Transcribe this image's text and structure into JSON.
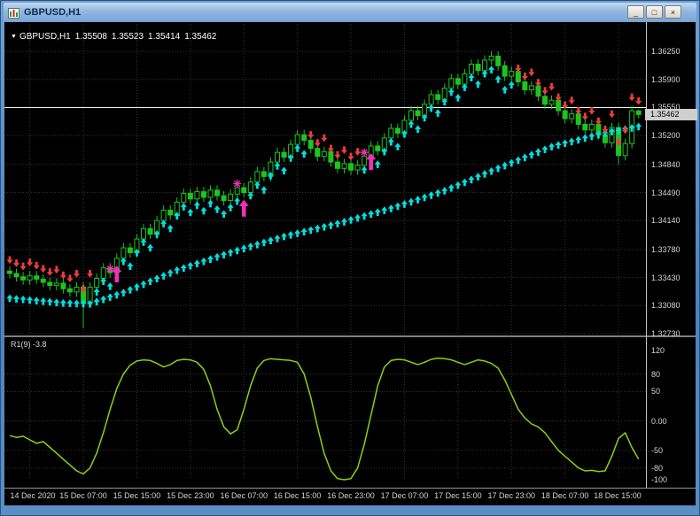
{
  "window": {
    "title": "GBPUSD,H1",
    "controls": [
      {
        "name": "minimize",
        "glyph": "_"
      },
      {
        "name": "restore",
        "glyph": "□"
      },
      {
        "name": "close",
        "glyph": "×"
      }
    ]
  },
  "quote_bar": {
    "dropdown_glyph": "▼",
    "symbol": "GBPUSD,H1",
    "open": "1.35508",
    "high": "1.35523",
    "low": "1.35414",
    "close": "1.35462"
  },
  "indicator_panel": {
    "label": "R1(9) -3.8"
  },
  "colors": {
    "background": "#000000",
    "grid": "#343434",
    "candle": "#1fc41f",
    "trend_ribbon": "#00e0e0",
    "sell_arrows": "#ee3c3c",
    "buy_signals": "#f031b5",
    "oscillator_line": "#86d412",
    "hline": "#f0f0f0",
    "axis_text": "#d4d4d4",
    "price_tag_bg": "#cfcfcf"
  },
  "chart_data": [
    {
      "type": "candlestick",
      "title": "GBPUSD,H1",
      "current_price": "1.35462",
      "y_axis": {
        "top": 1.3625,
        "bottom": 1.3273,
        "tick_values": [
          1.3625,
          1.359,
          1.3555,
          1.352,
          1.3484,
          1.3449,
          1.3414,
          1.3378,
          1.3343,
          1.3308,
          1.3273
        ],
        "tick_labels": [
          "1.36250",
          "1.35900",
          "1.35550",
          "1.35200",
          "1.34840",
          "1.34490",
          "1.34140",
          "1.33780",
          "1.33430",
          "1.33080",
          "1.32730"
        ]
      },
      "x_axis": {
        "tick_labels": [
          "14 Dec 2020",
          "15 Dec 07:00",
          "15 Dec 15:00",
          "15 Dec 23:00",
          "16 Dec 07:00",
          "16 Dec 15:00",
          "16 Dec 23:00",
          "17 Dec 07:00",
          "17 Dec 15:00",
          "17 Dec 23:00",
          "18 Dec 07:00",
          "18 Dec 15:00"
        ],
        "first_tick_bar": 3,
        "bars_per_tick": 8
      },
      "bar0_open": 1.3351,
      "closes": [
        1.3348,
        1.3344,
        1.334,
        1.3345,
        1.3341,
        1.3337,
        1.3333,
        1.3336,
        1.3329,
        1.3325,
        1.3331,
        1.3312,
        1.3331,
        1.3342,
        1.3355,
        1.3349,
        1.3367,
        1.338,
        1.3374,
        1.3391,
        1.3404,
        1.3397,
        1.3414,
        1.3427,
        1.3421,
        1.3437,
        1.3448,
        1.3441,
        1.345,
        1.3443,
        1.3452,
        1.3445,
        1.3439,
        1.3447,
        1.3455,
        1.3449,
        1.3462,
        1.3475,
        1.3469,
        1.3487,
        1.3499,
        1.3493,
        1.3509,
        1.3521,
        1.3514,
        1.3504,
        1.3494,
        1.35,
        1.3487,
        1.3479,
        1.3485,
        1.3477,
        1.3483,
        1.3494,
        1.3507,
        1.3501,
        1.3517,
        1.3529,
        1.3523,
        1.3539,
        1.3551,
        1.3545,
        1.3559,
        1.3571,
        1.3565,
        1.3579,
        1.3591,
        1.3584,
        1.3597,
        1.3609,
        1.3601,
        1.3614,
        1.3619,
        1.3607,
        1.3594,
        1.36,
        1.3587,
        1.3577,
        1.3582,
        1.3569,
        1.3559,
        1.3564,
        1.3551,
        1.3541,
        1.3547,
        1.3534,
        1.3527,
        1.3534,
        1.3521,
        1.3511,
        1.353,
        1.3495,
        1.351,
        1.3551,
        1.35462
      ],
      "wick_overrides": {
        "11": {
          "low": 1.328
        },
        "91": {
          "low": 1.3484
        },
        "94": {
          "open": 1.35508,
          "high": 1.35523,
          "low": 1.35414,
          "close": 1.35462
        }
      },
      "hline_price": 1.3555,
      "trend_up_segments": [
        [
          13,
          44
        ],
        [
          53,
          75
        ]
      ],
      "trend_down_segments": [
        [
          0,
          12
        ],
        [
          45,
          52
        ],
        [
          76,
          94
        ]
      ],
      "slow_ribbon_anchors": [
        [
          0,
          1.3322
        ],
        [
          8,
          1.3316
        ],
        [
          12,
          1.3315
        ],
        [
          17,
          1.3329
        ],
        [
          25,
          1.3357
        ],
        [
          33,
          1.3379
        ],
        [
          41,
          1.3399
        ],
        [
          49,
          1.3415
        ],
        [
          57,
          1.3434
        ],
        [
          65,
          1.3456
        ],
        [
          73,
          1.3484
        ],
        [
          81,
          1.3511
        ],
        [
          89,
          1.3528
        ],
        [
          94,
          1.3536
        ]
      ],
      "buy_arrow_bars": [
        16,
        35,
        54
      ],
      "buy_star_bars": [
        15,
        34,
        53
      ]
    },
    {
      "type": "line",
      "name": "R1(9)",
      "current_value": "-3.8",
      "y_axis": {
        "max": 120,
        "min": -100,
        "tick_values": [
          120,
          80,
          50,
          0,
          -50,
          -80,
          -100
        ],
        "tick_labels": [
          "120",
          "80",
          "50",
          "0.00",
          "-50",
          "-80",
          "-100"
        ],
        "dotted_levels": [
          80,
          50,
          0,
          -50,
          -80
        ]
      },
      "values": [
        -25,
        -28,
        -26,
        -32,
        -38,
        -35,
        -45,
        -55,
        -65,
        -75,
        -85,
        -90,
        -80,
        -55,
        -20,
        20,
        55,
        80,
        95,
        102,
        104,
        103,
        98,
        92,
        96,
        103,
        105,
        104,
        100,
        88,
        60,
        20,
        -10,
        -22,
        -15,
        20,
        60,
        90,
        103,
        106,
        105,
        104,
        103,
        100,
        80,
        40,
        -10,
        -55,
        -85,
        -98,
        -100,
        -98,
        -80,
        -40,
        10,
        60,
        92,
        103,
        105,
        104,
        100,
        96,
        100,
        105,
        107,
        106,
        104,
        100,
        96,
        100,
        104,
        102,
        98,
        90,
        70,
        45,
        20,
        5,
        -5,
        -10,
        -20,
        -35,
        -50,
        -60,
        -70,
        -80,
        -85,
        -84,
        -86,
        -85,
        -60,
        -30,
        -20,
        -45,
        -65
      ]
    }
  ]
}
